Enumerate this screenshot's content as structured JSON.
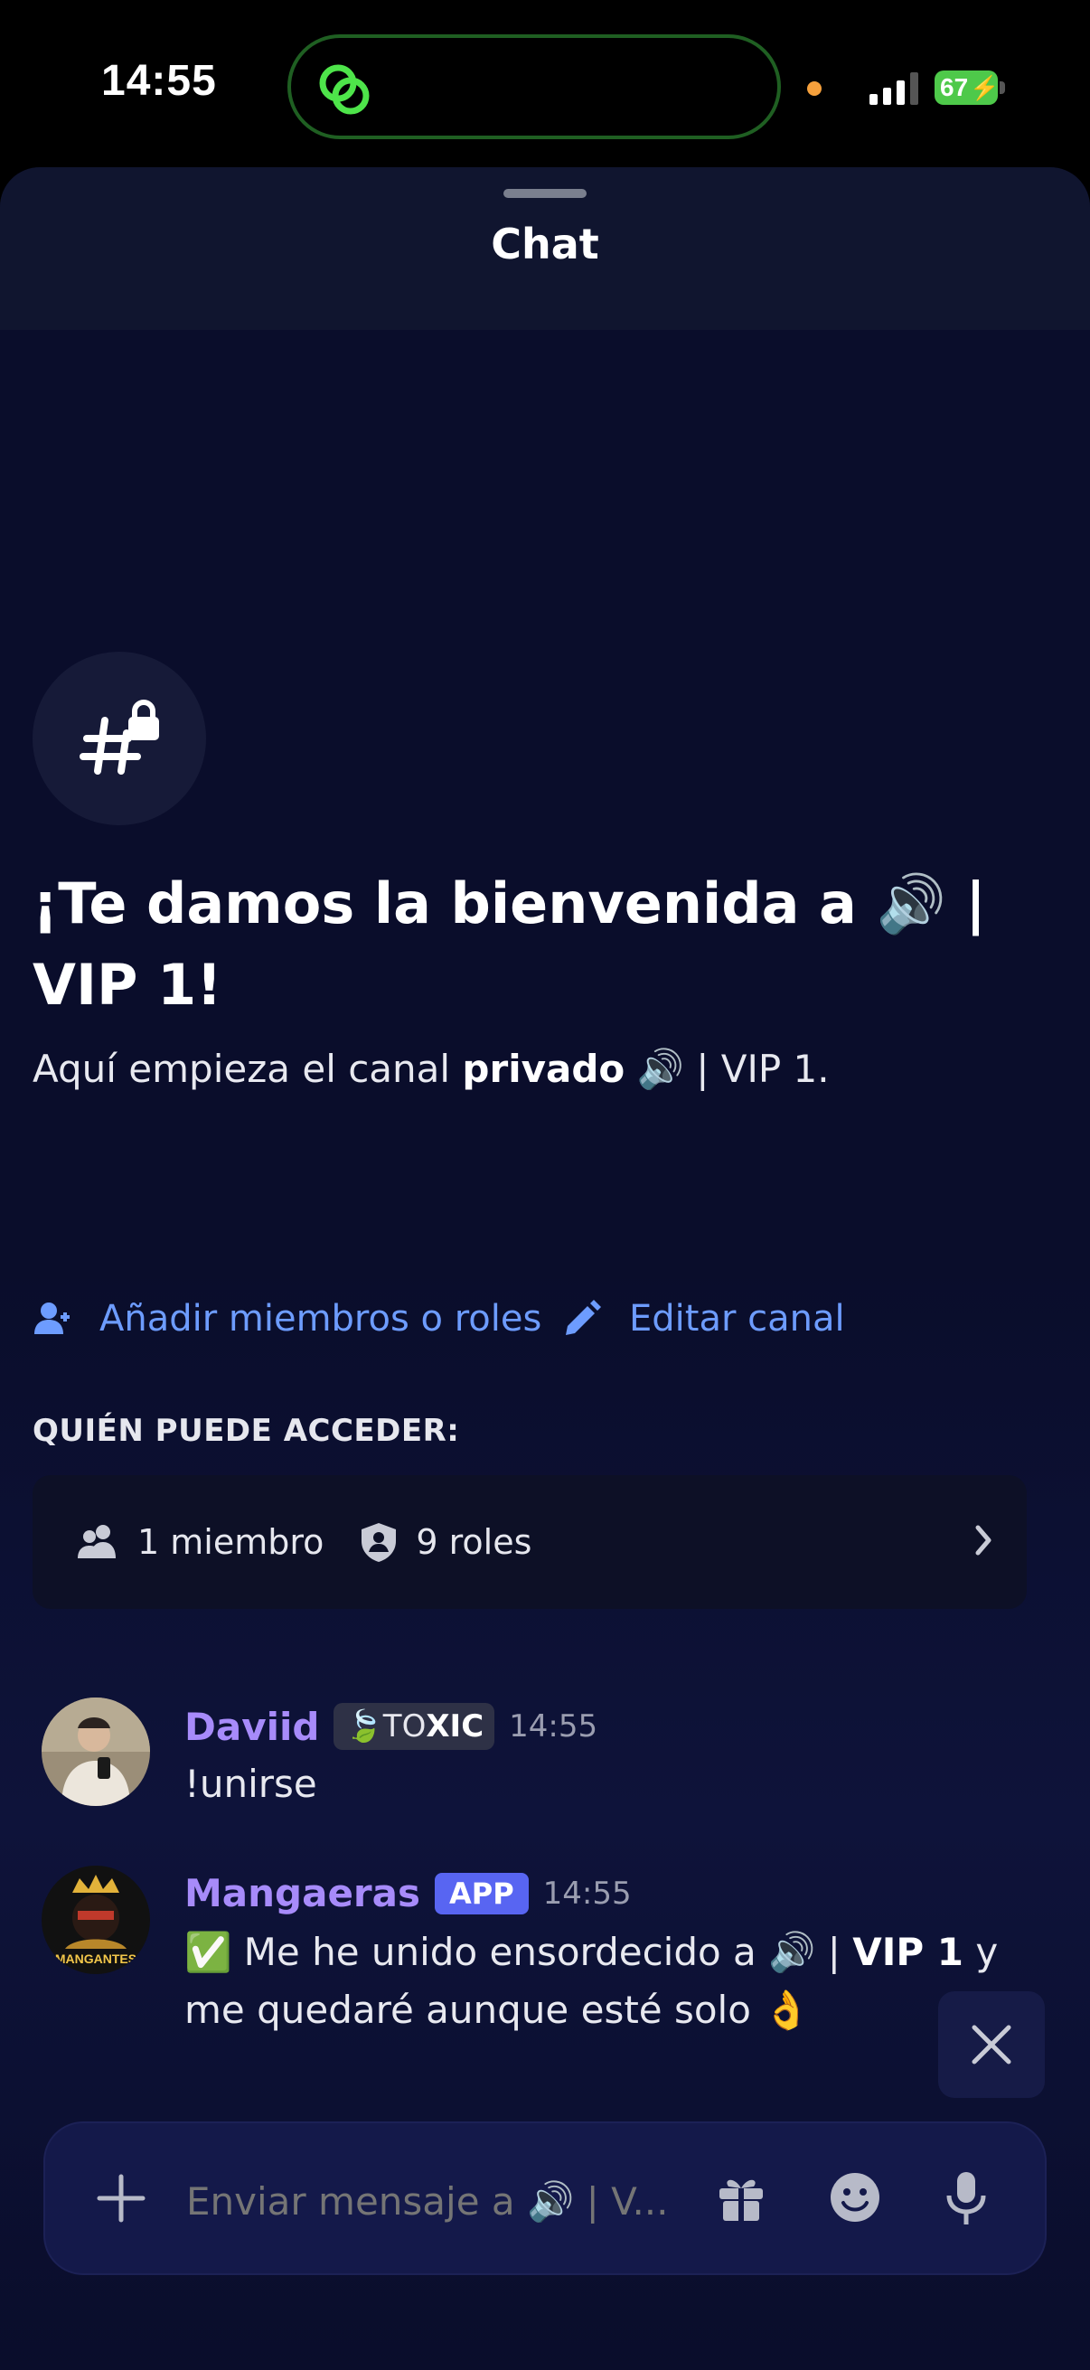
{
  "status_bar": {
    "time": "14:55",
    "battery": "67",
    "icons": [
      "link-icon",
      "signal-icon",
      "battery-icon"
    ]
  },
  "header": {
    "title": "Chat"
  },
  "channel": {
    "icon": "private-channel-hash-lock-icon",
    "welcome_title": "¡Te damos la bienvenida a 🔊 | VIP 1!",
    "subtitle_prefix": "Aquí empieza el canal ",
    "subtitle_bold": "privado",
    "subtitle_suffix": " 🔊 | VIP 1.",
    "actions": {
      "add_members": "Añadir miembros o roles",
      "edit_channel": "Editar canal"
    },
    "access": {
      "label": "QUIÉN PUEDE ACCEDER:",
      "members": "1 miembro",
      "roles": "9 roles"
    }
  },
  "messages": [
    {
      "username": "Daviid",
      "username_color": "#a78bfa",
      "tag_emoji": "🍃",
      "tag_text_pre": "TO",
      "tag_text_bold": "XIC",
      "time": "14:55",
      "body": "!unirse"
    },
    {
      "username": "Mangaeras",
      "username_color": "#a78bfa",
      "badge": "APP",
      "time": "14:55",
      "body_prefix": "✅ Me he unido ensordecido a 🔊 | ",
      "body_bold": "VIP 1",
      "body_suffix": " y me quedaré aunque esté solo 👌",
      "avatar_text": "LOS MANGANTES"
    }
  ],
  "composer": {
    "placeholder": "Enviar mensaje a 🔊 | V..."
  },
  "colors": {
    "accent_link": "#6d9cff",
    "app_badge": "#5865f2",
    "background": "#0a0d2b"
  }
}
